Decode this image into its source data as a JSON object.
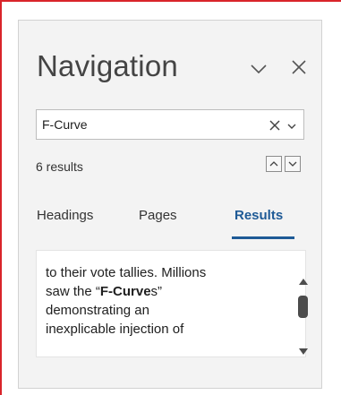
{
  "pane": {
    "title": "Navigation"
  },
  "search": {
    "value": "F-Curve"
  },
  "results": {
    "count_label": "6 results"
  },
  "tabs": [
    {
      "label": "Headings",
      "active": false
    },
    {
      "label": "Pages",
      "active": false
    },
    {
      "label": "Results",
      "active": true
    }
  ],
  "result_snippet": {
    "line1": "to their vote tallies.  Millions",
    "line2_pre": "saw the “",
    "line2_bold": "F-Curve",
    "line2_post": "s”",
    "line3": "demonstrating an",
    "line4": "inexplicable injection of"
  },
  "colors": {
    "active_tab": "#1e5a96",
    "frame_border": "#d9242a",
    "pane_background": "#f3f3f3"
  },
  "icons": {
    "title_options": "chevron-down-icon",
    "close": "close-icon",
    "search_clear": "close-icon",
    "search_options": "chevron-down-icon",
    "previous_result": "chevron-up-icon",
    "next_result": "chevron-down-icon",
    "scroll_up": "triangle-up-icon",
    "scroll_down": "triangle-down-icon"
  }
}
